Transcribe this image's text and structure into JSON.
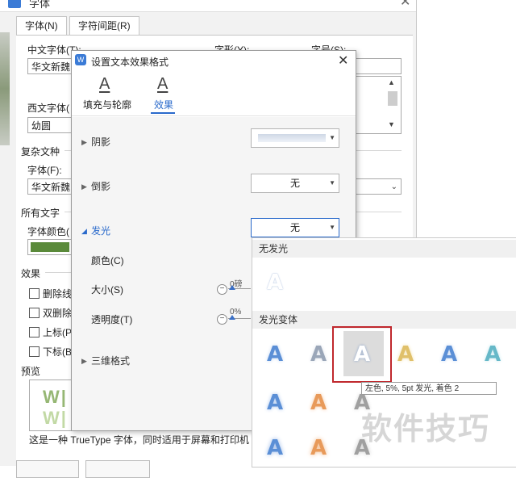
{
  "font_dialog": {
    "title": "字体",
    "tabs": [
      "字体(N)",
      "字符间距(R)"
    ],
    "cn_font_label": "中文字体(T):",
    "cn_font_value": "华文新魏",
    "style_label": "字形(Y):",
    "size_label": "字号(S):",
    "west_font_label": "西文字体(",
    "west_font_value": "幼圆",
    "complex_section": "复杂文种",
    "complex_font_label": "字体(F):",
    "complex_font_value": "华文新魏",
    "all_text_section": "所有文字",
    "font_color_label": "字体颜色(",
    "font_color_value": "#5a8a3a",
    "effects_section": "效果",
    "effects": [
      "删除线",
      "双删除",
      "上标(P",
      "下标(B"
    ],
    "preview_section": "预览",
    "preview_text": "W|",
    "status_text": "这是一种 TrueType 字体，同时适用于屏幕和打印机"
  },
  "effect_dialog": {
    "title": "设置文本效果格式",
    "tabs": [
      {
        "label": "填充与轮廓",
        "icon": "text-fill-icon"
      },
      {
        "label": "效果",
        "icon": "text-effect-icon",
        "active": true
      }
    ],
    "sections": {
      "shadow": "阴影",
      "reflection": "倒影",
      "reflection_value": "无",
      "glow": "发光",
      "glow_value": "无",
      "color_label": "颜色(C)",
      "size_label": "大小(S)",
      "size_value": "0磅",
      "transparency_label": "透明度(T)",
      "transparency_value": "0%",
      "three_d": "三维格式"
    }
  },
  "glow_panel": {
    "no_glow_header": "无发光",
    "variants_header": "发光变体",
    "tooltip": "左色, 5%, 5pt 发光, 着色 2",
    "row1_colors": [
      "#5b8fd6",
      "#9aa6b8",
      "#ffffff",
      "#e0c06a",
      "#5b8fd6",
      "#66b8c8"
    ],
    "row2_colors": [
      "#5b8fd6",
      "#e89a5a",
      "#a0a0a0"
    ],
    "row3_colors": [
      "#5b8fd6",
      "#e89a5a",
      "#a0a0a0"
    ]
  },
  "watermark": "软件技巧"
}
